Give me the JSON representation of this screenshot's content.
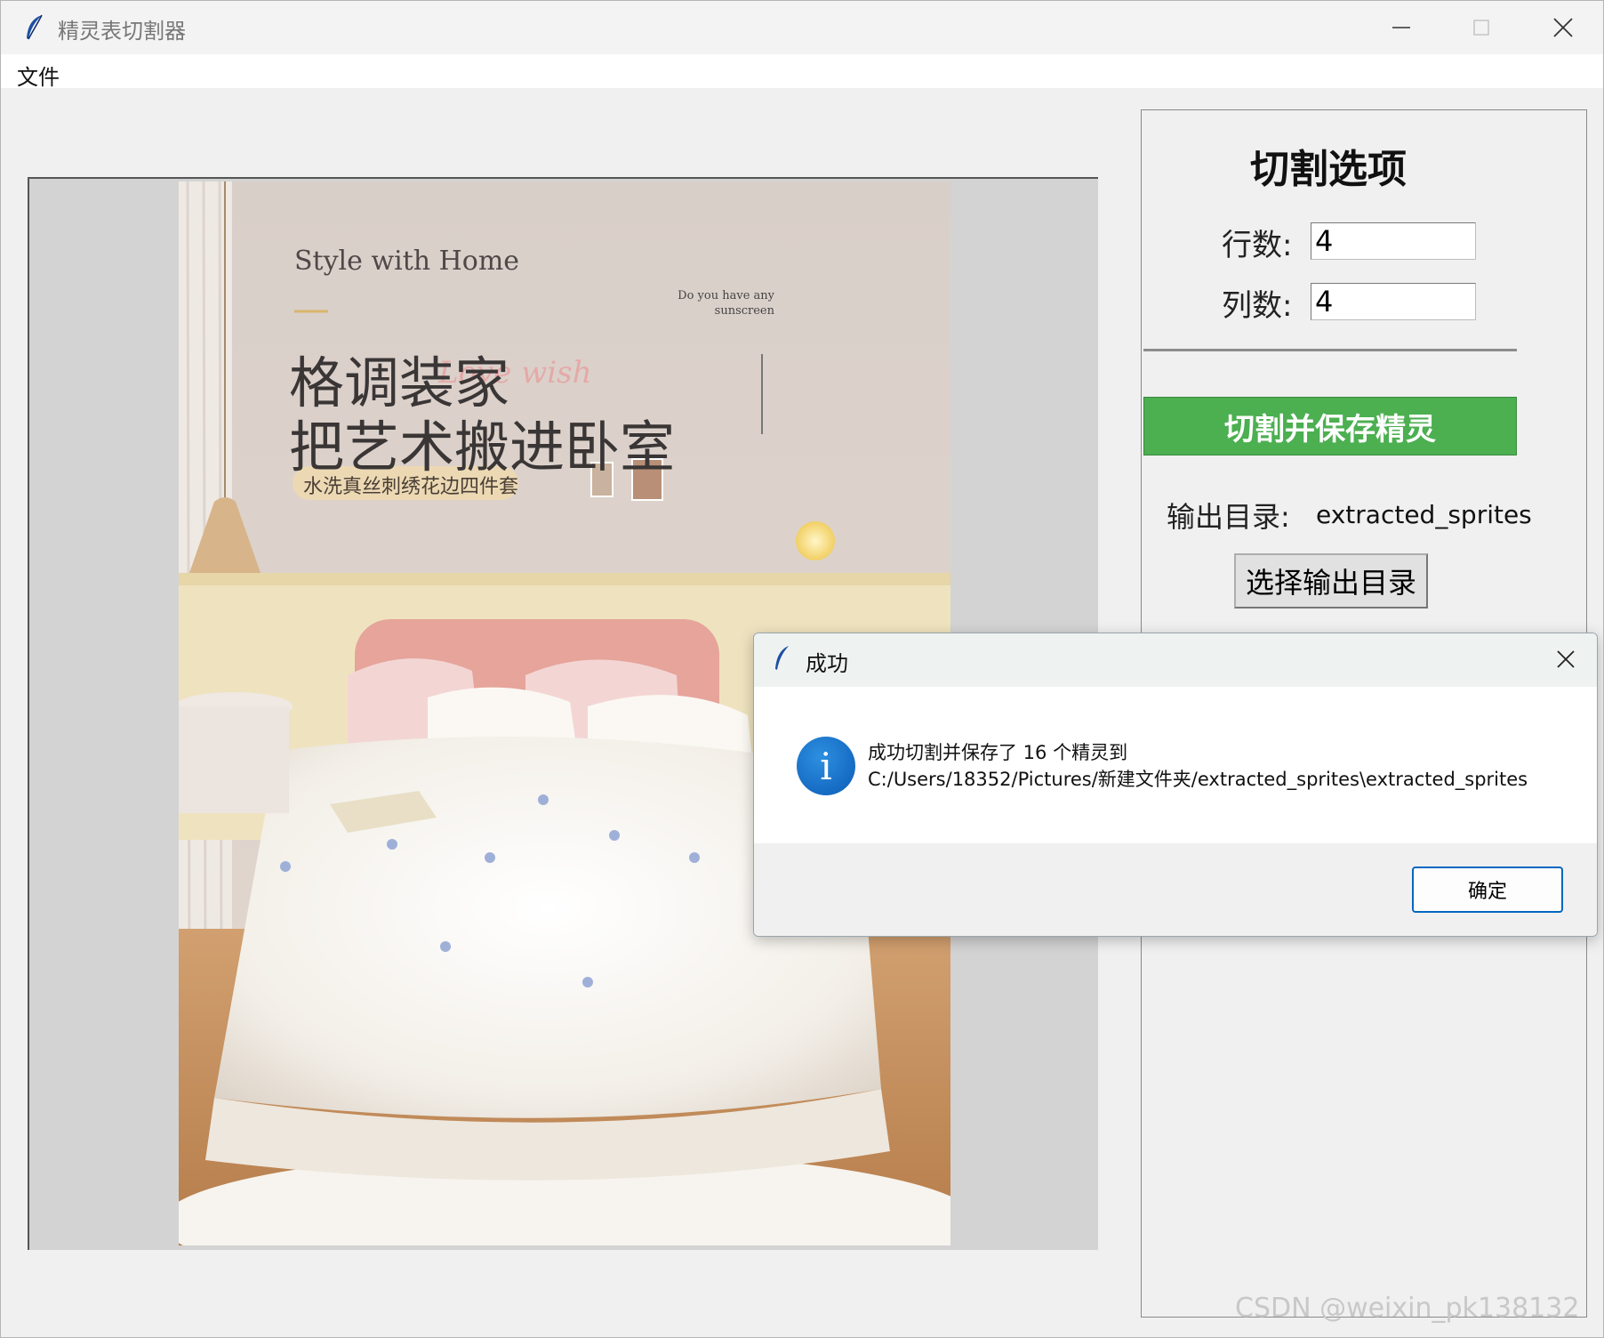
{
  "window": {
    "title": "精灵表切割器"
  },
  "menubar": {
    "file_label": "文件"
  },
  "preview_image": {
    "headline_en": "Style with Home",
    "tagline": "Do you have any sunscreen",
    "headline_line1": "格调装家",
    "headline_line2": "把艺术搬进卧室",
    "badge": "水洗真丝刺绣花边四件套"
  },
  "panel": {
    "title": "切割选项",
    "rows_label": "行数:",
    "rows_value": "4",
    "cols_label": "列数:",
    "cols_value": "4",
    "cut_button": "切割并保存精灵",
    "output_label": "输出目录:",
    "output_value": "extracted_sprites",
    "choose_button": "选择输出目录"
  },
  "dialog": {
    "title": "成功",
    "message_line1": "成功切割并保存了 16 个精灵到",
    "message_line2": "C:/Users/18352/Pictures/新建文件夹/extracted_sprites\\extracted_sprites",
    "ok_button": "确定"
  },
  "watermark": "CSDN @weixin_pk138132",
  "colors": {
    "accent_green": "#4caf50",
    "dialog_button_border": "#0067c0",
    "info_blue": "#0b5cb6"
  }
}
